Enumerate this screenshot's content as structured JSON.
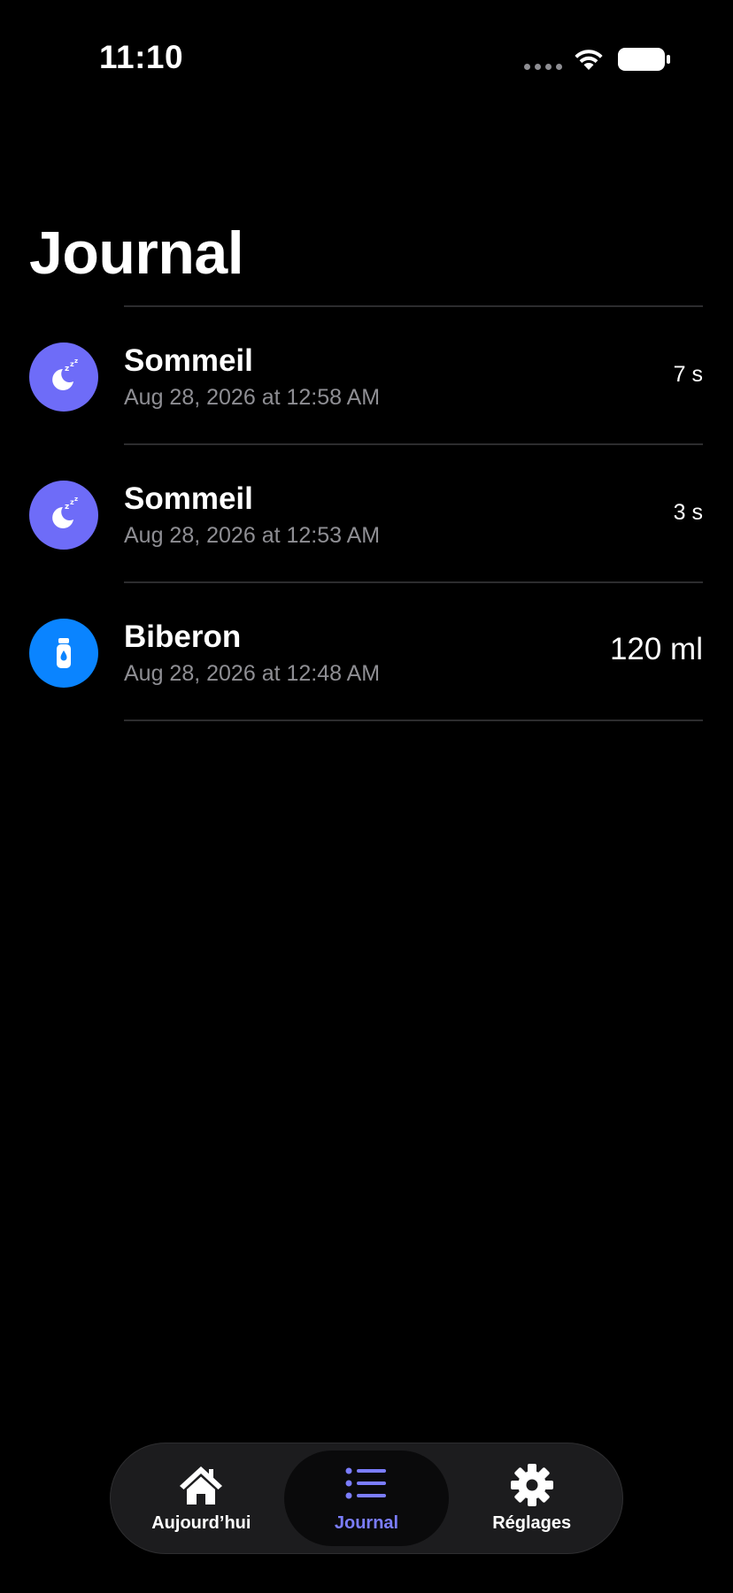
{
  "status_bar": {
    "time": "11:10"
  },
  "header": {
    "title": "Journal"
  },
  "log": [
    {
      "title": "Sommeil",
      "subtitle": "Aug 28, 2026 at 12:58 AM",
      "value": "7 s",
      "icon": "sleep-moon-icon",
      "color": "#6e6cf8"
    },
    {
      "title": "Sommeil",
      "subtitle": "Aug 28, 2026 at 12:53 AM",
      "value": "3 s",
      "icon": "sleep-moon-icon",
      "color": "#6e6cf8"
    },
    {
      "title": "Biberon",
      "subtitle": "Aug 28, 2026 at 12:48 AM",
      "value": "120 ml",
      "icon": "baby-bottle-icon",
      "color": "#0a84ff"
    }
  ],
  "tab_bar": {
    "tabs": [
      {
        "label": "Aujourd’hui",
        "icon": "house-icon",
        "active": false
      },
      {
        "label": "Journal",
        "icon": "list-icon",
        "active": true
      },
      {
        "label": "Réglages",
        "icon": "gear-icon",
        "active": false
      }
    ],
    "accent": "#7b7dff"
  }
}
